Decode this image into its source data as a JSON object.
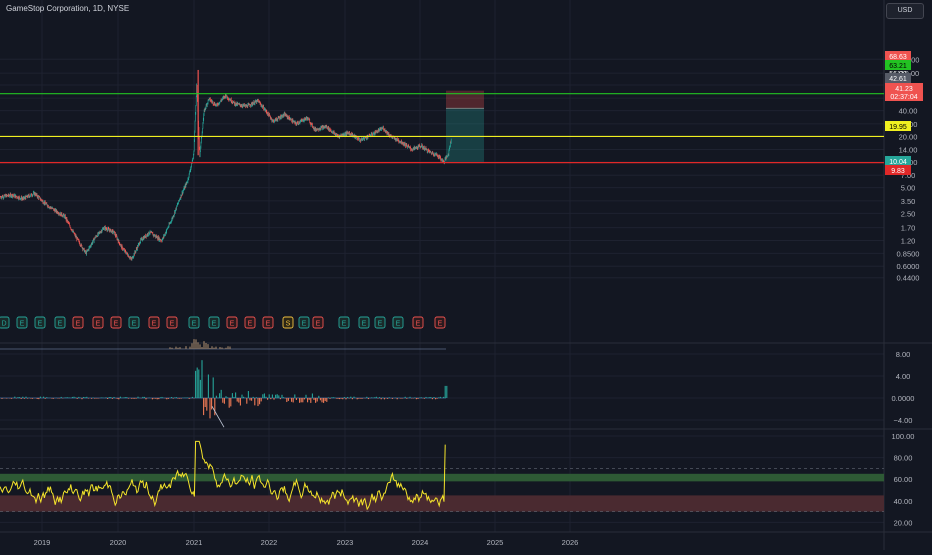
{
  "header": {
    "title": "GameStop Corporation, 1D, NYSE",
    "currency": "USD"
  },
  "colors": {
    "background": "#131722",
    "grid": "#1e2230",
    "axis_text": "#b2b5be",
    "candle_up": "#26a69a",
    "candle_down": "#ef5350",
    "green_line": "#22c222",
    "yellow_line": "#f0f020",
    "red_line": "#e02828",
    "rsi_line": "#f5e52b",
    "rsi_upper_band": "#2e5a35",
    "rsi_lower_band": "#4a2a30"
  },
  "price_axis": {
    "ticks": [
      "160.00",
      "110.00",
      "80.00",
      "56.00",
      "40.00",
      "28.00",
      "20.00",
      "14.00",
      "10.00",
      "7.00",
      "5.00",
      "3.50",
      "2.50",
      "1.70",
      "1.20",
      "0.8500",
      "0.6000",
      "0.4400"
    ]
  },
  "price_labels": [
    {
      "text": "68.63",
      "bg": "#ef5350",
      "fg": "#ffffff",
      "kind": "target-stop"
    },
    {
      "text": "63.21",
      "bg": "#22c222",
      "fg": "#000000",
      "kind": "green-line"
    },
    {
      "text": "56.00",
      "bg": "#ef5350",
      "fg": "#ffffff",
      "kind": "hidden"
    },
    {
      "text": "42.61",
      "bg": "#555a66",
      "fg": "#ffffff",
      "kind": "entry"
    },
    {
      "text": "41.23",
      "bg": "#ef5350",
      "fg": "#ffffff",
      "kind": "last-price"
    },
    {
      "text": "02:37:04",
      "bg": "#ef5350",
      "fg": "#ffffff",
      "kind": "countdown"
    },
    {
      "text": "19.95",
      "bg": "#f0f020",
      "fg": "#000000",
      "kind": "yellow-line"
    },
    {
      "text": "10.04",
      "bg": "#26a69a",
      "fg": "#ffffff",
      "kind": "target"
    },
    {
      "text": "9.83",
      "bg": "#e02828",
      "fg": "#ffffff",
      "kind": "red-line"
    }
  ],
  "horizontal_lines": [
    {
      "price": 63.21,
      "color": "#22c222"
    },
    {
      "price": 19.95,
      "color": "#f0f020"
    },
    {
      "price": 9.83,
      "color": "#e02828"
    }
  ],
  "position_tool": {
    "entry": 42.61,
    "stop": 68.63,
    "target": 10.04
  },
  "events": [
    {
      "label": "D",
      "type": "dividend"
    },
    {
      "label": "E",
      "type": "earnings-pos"
    },
    {
      "label": "E",
      "type": "earnings-pos"
    },
    {
      "label": "E",
      "type": "earnings-pos"
    },
    {
      "label": "E",
      "type": "earnings-neg"
    },
    {
      "label": "E",
      "type": "earnings-neg"
    },
    {
      "label": "E",
      "type": "earnings-neg"
    },
    {
      "label": "E",
      "type": "earnings-pos"
    },
    {
      "label": "E",
      "type": "earnings-neg"
    },
    {
      "label": "E",
      "type": "earnings-neg"
    },
    {
      "label": "E",
      "type": "earnings-pos"
    },
    {
      "label": "E",
      "type": "earnings-pos"
    },
    {
      "label": "E",
      "type": "earnings-neg"
    },
    {
      "label": "E",
      "type": "earnings-neg"
    },
    {
      "label": "E",
      "type": "earnings-neg"
    },
    {
      "label": "S",
      "type": "split"
    },
    {
      "label": "E",
      "type": "earnings-pos"
    },
    {
      "label": "E",
      "type": "earnings-neg"
    },
    {
      "label": "E",
      "type": "earnings-pos"
    },
    {
      "label": "E",
      "type": "earnings-pos"
    },
    {
      "label": "E",
      "type": "earnings-pos"
    },
    {
      "label": "E",
      "type": "earnings-pos"
    },
    {
      "label": "E",
      "type": "earnings-neg"
    },
    {
      "label": "E",
      "type": "earnings-neg"
    }
  ],
  "macd_axis": {
    "ticks": [
      "8.00",
      "4.00",
      "0.0000",
      "−4.00"
    ]
  },
  "rsi_axis": {
    "ticks": [
      "100.00",
      "80.00",
      "60.00",
      "40.00",
      "20.00"
    ]
  },
  "time_axis": {
    "labels": [
      "2019",
      "2020",
      "2021",
      "2022",
      "2023",
      "2024",
      "2025",
      "2026"
    ]
  }
}
